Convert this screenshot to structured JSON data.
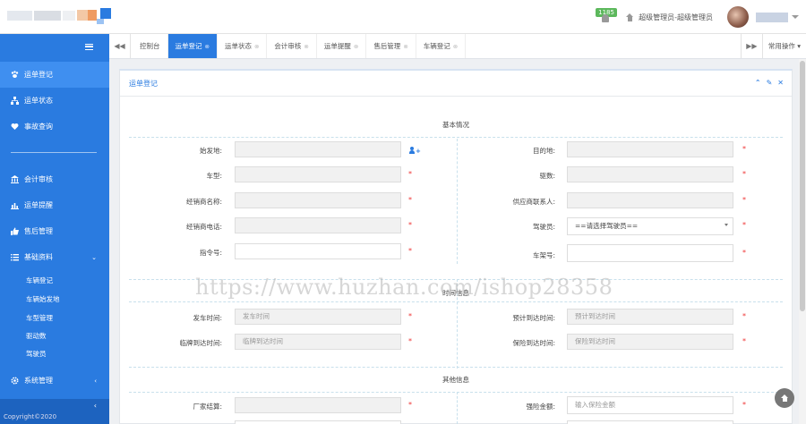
{
  "header": {
    "notification_count": "1185",
    "breadcrumb": "超级管理员-超级管理员"
  },
  "sidebar": {
    "items": [
      {
        "label": "运单登记",
        "icon": "paw-icon"
      },
      {
        "label": "运单状态",
        "icon": "sitemap-icon"
      },
      {
        "label": "事故查询",
        "icon": "heartbeat-icon"
      },
      {
        "label": "会计审核",
        "icon": "bank-icon"
      },
      {
        "label": "运单提醒",
        "icon": "bar-chart-icon"
      },
      {
        "label": "售后管理",
        "icon": "thumbs-up-icon"
      },
      {
        "label": "基础资料",
        "icon": "list-icon"
      },
      {
        "label": "系统管理",
        "icon": "gear-icon"
      }
    ],
    "subitems": [
      "车辆登记",
      "车辆始发地",
      "车型管理",
      "驱动数",
      "驾驶员"
    ],
    "expanded_chevron": "⌄",
    "system_chevron": "‹",
    "footer": "Copyright©2020",
    "collapse_icon": "‹"
  },
  "tabbar": {
    "left_arrow": "◀◀",
    "tabs": [
      {
        "label": "控制台",
        "closable": false
      },
      {
        "label": "运单登记",
        "closable": true,
        "active": true
      },
      {
        "label": "运单状态",
        "closable": true
      },
      {
        "label": "会计审核",
        "closable": true
      },
      {
        "label": "运单提醒",
        "closable": true
      },
      {
        "label": "售后管理",
        "closable": true
      },
      {
        "label": "车辆登记",
        "closable": true
      }
    ],
    "close_glyph": "⊗",
    "right_arrow": "▶▶",
    "common_ops": "常用操作 ▾"
  },
  "panel": {
    "title": "运单登记",
    "tools": {
      "collapse": "⌃",
      "settings": "✎",
      "close": "✕"
    },
    "sections": {
      "basic": "基本情况",
      "time": "时间信息",
      "other": "其他信息"
    },
    "fields": {
      "origin": {
        "label": "始发地:",
        "value": ""
      },
      "destination": {
        "label": "目的地:",
        "value": ""
      },
      "vehicle_type": {
        "label": "车型:",
        "value": ""
      },
      "drive_count": {
        "label": "驱数:",
        "value": ""
      },
      "dealer_name": {
        "label": "经销商名称:",
        "value": ""
      },
      "supplier_contact": {
        "label": "供应商联系人:",
        "value": ""
      },
      "dealer_phone": {
        "label": "经销商电话:",
        "value": ""
      },
      "driver": {
        "label": "驾驶员:",
        "selected": "==请选择驾驶员=="
      },
      "order_no": {
        "label": "指令号:",
        "value": ""
      },
      "frame_no": {
        "label": "车架号:",
        "value": ""
      },
      "depart_time": {
        "label": "发车时间:",
        "placeholder": "发车时间"
      },
      "eta": {
        "label": "预计到达时间:",
        "placeholder": "预计到达时间"
      },
      "temp_plate_time": {
        "label": "临牌到达时间:",
        "placeholder": "临牌到达时间"
      },
      "insurance_time": {
        "label": "保险到达时间:",
        "placeholder": "保险到达时间"
      },
      "factory_settlement": {
        "label": "厂家结算:",
        "value": ""
      },
      "insurance_amount": {
        "label": "强险金额:",
        "placeholder": "输入保险金额"
      }
    },
    "required_mark": "*"
  },
  "watermark": "https://www.huzhan.com/ishop28358"
}
